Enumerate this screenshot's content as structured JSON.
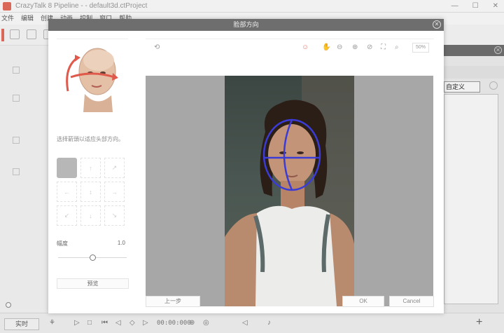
{
  "app": {
    "title": "CrazyTalk 8 Pipeline - - default3d.ctProject",
    "window_controls": [
      "—",
      "☐",
      "✕"
    ],
    "menu": [
      "文件",
      "编辑",
      "创建",
      "动画",
      "控制",
      "窗口",
      "帮助"
    ]
  },
  "right_panel": {
    "tab_label": "自定义",
    "close": "✕"
  },
  "bottom": {
    "realtime_label": "实时",
    "timecode": "00:00:000",
    "add_label": "+",
    "transport_glyphs": [
      "▷",
      "□",
      "⏮",
      "◁",
      "◇",
      "▷",
      "⏭",
      "⊕",
      "◎",
      "▷",
      "◁",
      "♪"
    ]
  },
  "dialog": {
    "title": "脸部方向",
    "close": "✕",
    "hint": "选择箭頭以适应头部方向。",
    "amplitude_label": "幅度",
    "amplitude_value": "1.0",
    "amplitude_level": 0.5,
    "preview_label": "预览",
    "prev_label": "上一步",
    "ok_label": "OK",
    "cancel_label": "Cancel",
    "zoom_label": "50%",
    "directions": [
      "",
      "↑",
      "↗",
      "←",
      "↕",
      "→",
      "↙",
      "↓",
      "↘"
    ],
    "active_direction": 0,
    "toolbar_icons": [
      "rotate-icon",
      "face-icon",
      "hand-icon",
      "zoom-out-icon",
      "zoom-in-icon",
      "reset-icon",
      "fit-icon",
      "actual-size-icon"
    ],
    "accent_red": "#e87b6e",
    "guide_color": "#3b3bd6"
  }
}
